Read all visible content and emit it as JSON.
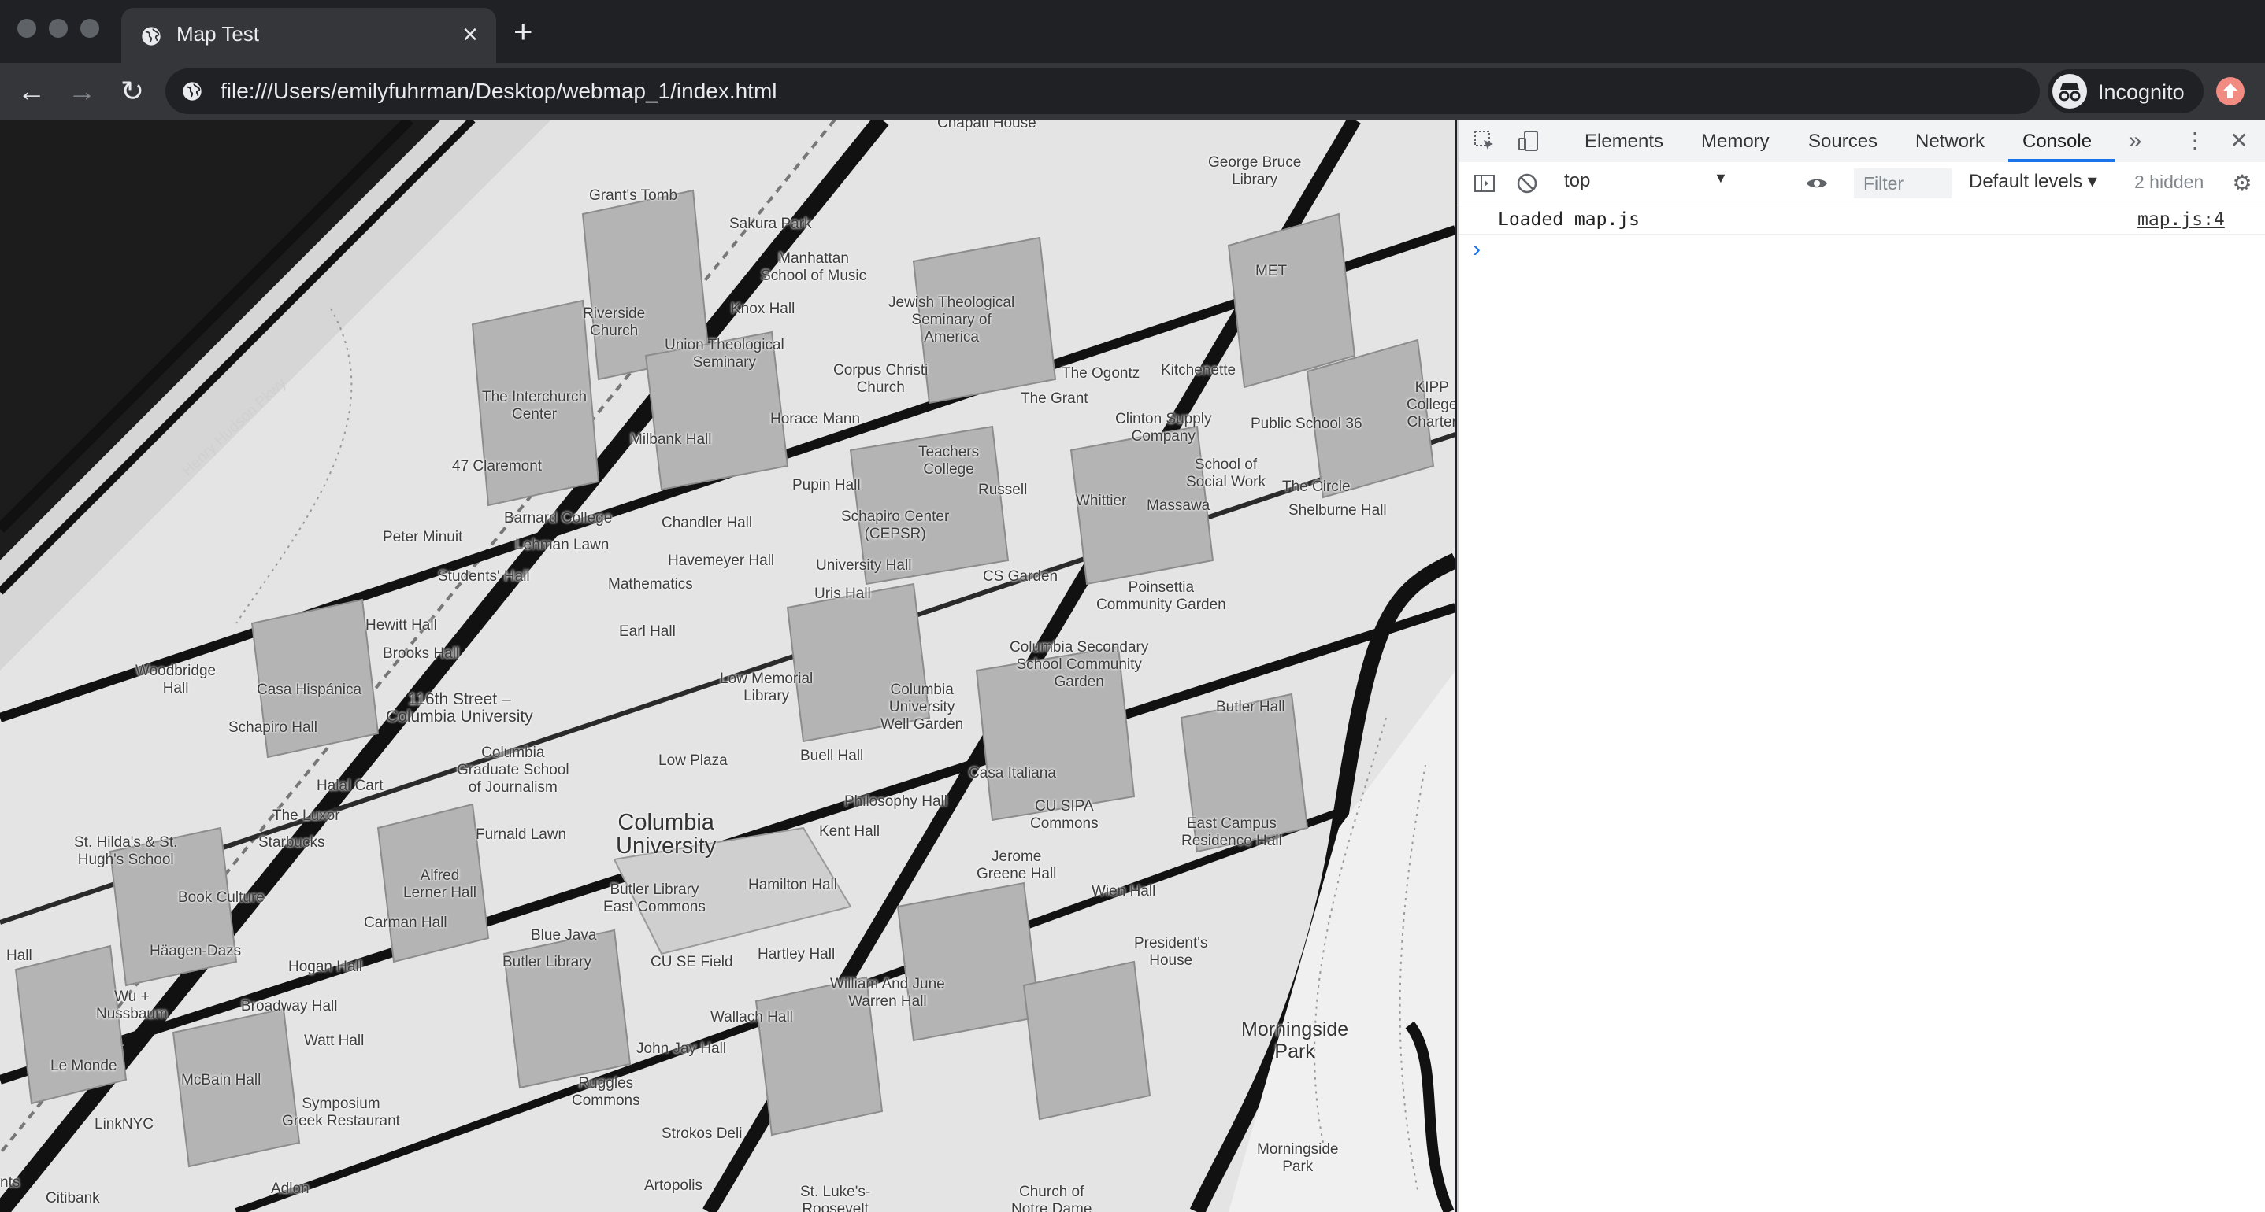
{
  "browser": {
    "tab_title": "Map Test",
    "tab_close": "×",
    "new_tab": "+",
    "url": "file:///Users/emilyfuhrman/Desktop/webmap_1/index.html",
    "profile_label": "Incognito",
    "nav": {
      "back": "←",
      "forward": "→",
      "reload": "↻"
    }
  },
  "map": {
    "labels": {
      "chapati_house": "Chapati House",
      "george_bruce": "George Bruce\nLibrary",
      "grants_tomb": "Grant's Tomb",
      "sakura_park": "Sakura Park",
      "manhattan_school": "Manhattan\nSchool of Music",
      "met": "MET",
      "knox_hall": "Knox Hall",
      "jewish_theological": "Jewish Theological\nSeminary of\nAmerica",
      "riverside_church": "Riverside\nChurch",
      "union_theological": "Union Theological\nSeminary",
      "henry_hudson": "Henry Hudson Pkwy",
      "kipp": "KIPP\nCollege\nCharter",
      "corpus_christi": "Corpus Christi\nChurch",
      "the_ogontz": "The Ogontz",
      "kitchenette": "Kitchenette",
      "the_grant": "The Grant",
      "interchurch": "The Interchurch\nCenter",
      "horace_mann": "Horace Mann",
      "clinton_supply": "Clinton Supply\nCompany",
      "ps36": "Public School 36",
      "milbank": "Milbank Hall",
      "claremont": "47 Claremont",
      "teachers_college": "Teachers\nCollege",
      "social_work": "School of\nSocial Work",
      "pupin": "Pupin Hall",
      "russell": "Russell",
      "the_circle": "The Circle",
      "whittier": "Whittier",
      "massawa": "Massawa",
      "shelburne": "Shelburne Hall",
      "barnard": "Barnard College",
      "chandler": "Chandler Hall",
      "cepsr": "Schapiro Center\n(CEPSR)",
      "peter_minuit": "Peter Minuit",
      "lehman_lawn": "Lehman Lawn",
      "havemeyer": "Havemeyer Hall",
      "university_hall": "University Hall",
      "students_hall": "Students' Hall",
      "mathematics": "Mathematics",
      "cs_garden": "CS Garden",
      "poinsettia": "Poinsettia\nCommunity Garden",
      "uris": "Uris Hall",
      "hewitt": "Hewitt Hall",
      "earl": "Earl Hall",
      "secondary_school": "Columbia Secondary\nSchool Community\nGarden",
      "brooks": "Brooks Hall",
      "woodbridge": "Woodbridge\nHall",
      "casa_hispanica": "Casa Hispánica",
      "low_memorial": "Low Memorial\nLibrary",
      "street_116": "116th Street –\nColumbia University",
      "wellness": "Columbia\nUniversity\nWell Garden",
      "butler_hall": "Butler Hall",
      "schapiro_hall": "Schapiro Hall",
      "journalism": "Columbia\nGraduate School\nof Journalism",
      "low_plaza": "Low Plaza",
      "buell": "Buell Hall",
      "casa_italiana": "Casa Italiana",
      "halal": "Halal Cart",
      "philosophy": "Philosophy Hall",
      "cu_sipa": "CU SIPA\nCommons",
      "east_campus": "East Campus\nResidence Hall",
      "the_luxor": "The Luxor",
      "st_hildas": "St. Hilda's & St.\nHugh's School",
      "starbucks": "Starbucks",
      "furnald": "Furnald Lawn",
      "columbia_university": "Columbia\nUniversity",
      "kent": "Kent Hall",
      "jerome_greene": "Jerome\nGreene Hall",
      "alfred_lerner": "Alfred\nLerner Hall",
      "butler_commons": "Butler Library\nEast Commons",
      "hamilton": "Hamilton Hall",
      "wien": "Wien Hall",
      "book_culture": "Book Culture",
      "carman": "Carman Hall",
      "presidents_house": "President's\nHouse",
      "blue_java": "Blue Java",
      "hall_edge": "Hall",
      "haagen_dazs": "Häagen-Dazs",
      "hogan": "Hogan Hall",
      "butler_library": "Butler Library",
      "cu_se_field": "CU SE Field",
      "hartley": "Hartley Hall",
      "wu_nussbaum": "Wu +\nNussbaum",
      "broadway_hall": "Broadway Hall",
      "william_june": "William And June\nWarren Hall",
      "wallach": "Wallach Hall",
      "morningside_park": "Morningside\nPark",
      "watt": "Watt Hall",
      "john_jay": "John Jay Hall",
      "le_monde": "Le Monde",
      "mcbain": "McBain Hall",
      "ruggles": "Ruggles\nCommons",
      "symposium": "Symposium\nGreek Restaurant",
      "linknyc": "LinkNYC",
      "strokos": "Strokos Deli",
      "morningside_park_2": "Morningside\nPark",
      "adlon": "Adlon",
      "artopolis": "Artopolis",
      "st_lukes": "St. Luke's-\nRoosevelt",
      "church_notre_dame": "Church of\nNotre Dame",
      "citibank": "Citibank",
      "nts": "nts"
    }
  },
  "devtools": {
    "tabs": [
      "Elements",
      "Memory",
      "Sources",
      "Network",
      "Console"
    ],
    "active_tab": "Console",
    "more_tabs": "»",
    "context": "top",
    "filter_placeholder": "Filter",
    "levels": "Default levels ▾",
    "hidden_count": "2 hidden",
    "log": {
      "message": "Loaded map.js",
      "source": "map.js:4"
    },
    "prompt": "›"
  }
}
